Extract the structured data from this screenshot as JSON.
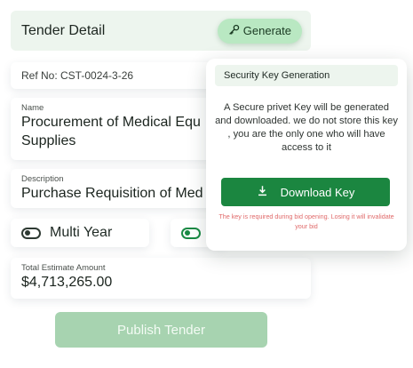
{
  "header": {
    "title": "Tender Detail",
    "generate_label": "Generate"
  },
  "form": {
    "ref": "Ref No: CST-0024-3-26",
    "name_label": "Name",
    "name_value_line1": "Procurement of Medical Equ",
    "name_value_line2": "Supplies",
    "description_label": "Description",
    "description_value": "Purchase Requisition of Med",
    "toggle_multi_year": "Multi Year",
    "amount_label": "Total Estimate Amount",
    "amount_value": "$4,713,265.00",
    "publish_label": "Publish Tender"
  },
  "modal": {
    "title": "Security Key Generation",
    "message": "A Secure privet Key will be generated and downloaded. we do not store this key , you are the only one who will have access to it",
    "download_label": "Download Key",
    "warning": "The key is required during bid opening. Losing it will invalidate your bid"
  },
  "colors": {
    "accent": "#1b8640",
    "warning": "#e06a6a",
    "header_bg": "#edf5ee",
    "publish_disabled": "#a7d3b0"
  },
  "icons": {
    "generate": "key-icon",
    "download": "download-icon"
  }
}
